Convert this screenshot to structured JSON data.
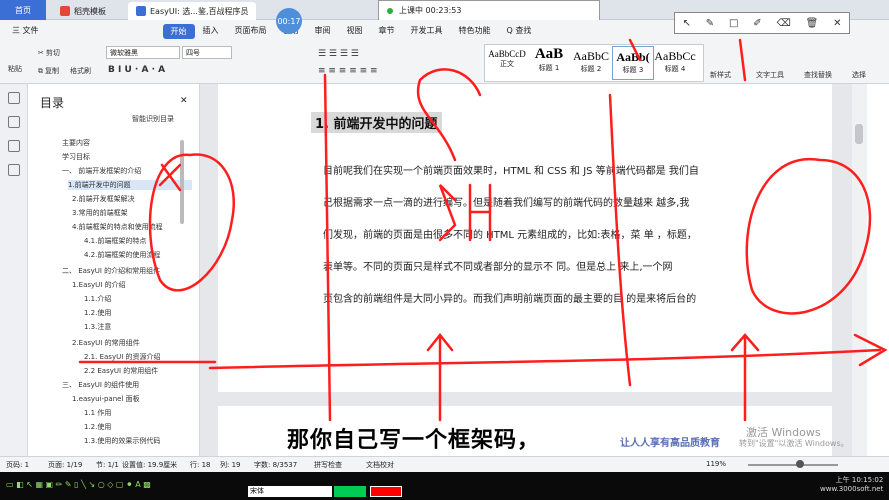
{
  "tabs": {
    "home": "首页",
    "template": "稻壳模板",
    "doc": "EasyUI: 选...鉴,百战程序员"
  },
  "recorder": {
    "status": "上课中 00:23:53",
    "timer": "00:17"
  },
  "menu": {
    "file": "三 文件",
    "items": [
      "开始",
      "插入",
      "页面布局",
      "引用",
      "审阅",
      "视图",
      "章节",
      "开发工具",
      "特色功能"
    ],
    "search": "Q 查找"
  },
  "ribbon": {
    "paste": "粘贴",
    "cut": "剪切",
    "copy": "复制",
    "format_painter": "格式刷",
    "font_name": "微软雅黑",
    "font_size": "四号",
    "styles": [
      {
        "sample": "AaBbCcD",
        "label": "正文"
      },
      {
        "sample": "AaB",
        "label": "标题 1"
      },
      {
        "sample": "AaBbC",
        "label": "标题 2"
      },
      {
        "sample": "AaBb(",
        "label": "标题 3"
      },
      {
        "sample": "AaBbCc",
        "label": "标题 4"
      }
    ],
    "new_style": "新样式",
    "text_tool": "文字工具",
    "find_replace": "查找替换",
    "select": "选择"
  },
  "toc": {
    "title": "目录",
    "smart": "智能识别目录",
    "items": [
      "主要内容",
      "学习目标",
      "一、 前端开发框架的介绍",
      "1.前端开发中的问题",
      "2.前端开发框架解决",
      "3.常用的前端框架",
      "4.前端框架的特点和使用流程",
      "4.1.前端框架的特点",
      "4.2.前端框架的使用流程",
      "二、 EasyUI 的介绍和常用组件",
      "1.EasyUI 的介绍",
      "1.1.介绍",
      "1.2.使用",
      "1.3.注意",
      "2.EasyUI 的常用组件",
      "2.1. EasyUI 的资源介绍",
      "2.2 EasyUI 的常用组件",
      "三、 EasyUI 的组件使用",
      "1.easyui-panel 面板",
      "1.1 作用",
      "1.2.使用",
      "1.3.使用的效果示例代码"
    ]
  },
  "document": {
    "heading": "1.  前端开发中的问题",
    "lines": [
      "目前呢我们在实现一个前端页面效果时，HTML 和 CSS 和 JS 等前端代码都是   我们自",
      "己根据需求一点一滴的进行编写。但是随着我们编写的前端代码的数量越来      越多,我",
      "们发现，前端的页面是由很多不同的 HTML 元素组成的，比如:表格，菜    单  ，标题，",
      "表单等。不同的页面只是样式不同或者部分的显示不      同。但是总上      来上,一个网",
      "页包含的前端组件是大同小异的。而我们声明前端页面的最主要的目    的是来将后台的"
    ]
  },
  "status": {
    "page": "页码: 1",
    "pages": "页面: 1/19",
    "section": "节: 1/1",
    "setting": "设置值: 19.9厘米",
    "row": "行: 18",
    "col": "列: 19",
    "words": "字数: 8/3537",
    "spell": "拼写检查",
    "proof": "文档校对",
    "zoom": "119%"
  },
  "subtitle": "那你自己写一个框架码，",
  "watermark": {
    "line1": "激活 Windows",
    "line2": "转到\"设置\"以激活 Windows。",
    "brand": "让人人享有高品质教育"
  },
  "bottom": {
    "font": "宋体",
    "clock_time": "上午 10:15:02",
    "site": "www.3000soft.net"
  },
  "colors": {
    "accent": "#3b6fd6",
    "annotation": "#ff1e1e"
  }
}
